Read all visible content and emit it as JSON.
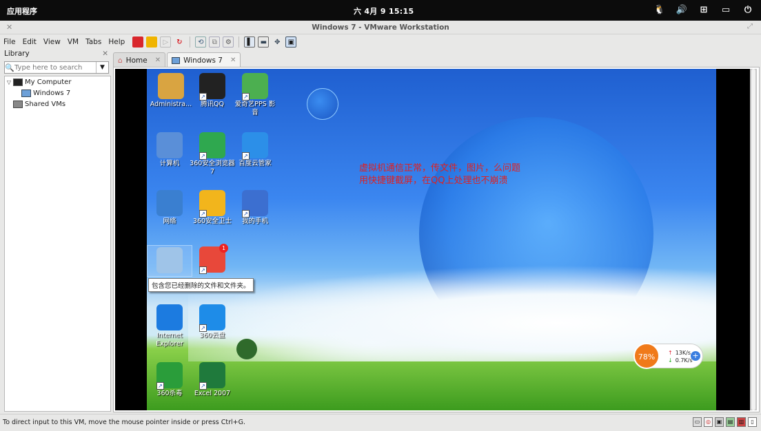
{
  "topbar": {
    "apps": "应用程序",
    "clock": "六 4月 9  15:15",
    "tray_icons": [
      "tux-icon",
      "volume-icon",
      "network-icon",
      "battery-icon",
      "power-icon"
    ]
  },
  "window": {
    "title": "Windows 7 - VMware Workstation"
  },
  "menu": [
    "File",
    "Edit",
    "View",
    "VM",
    "Tabs",
    "Help"
  ],
  "library": {
    "title": "Library",
    "search_placeholder": "Type here to search",
    "tree": [
      {
        "label": "My Computer"
      },
      {
        "label": "Windows 7"
      },
      {
        "label": "Shared VMs"
      }
    ]
  },
  "tabs": [
    {
      "label": "Home"
    },
    {
      "label": "Windows 7"
    }
  ],
  "desktop": {
    "icons": [
      {
        "label": "Administra...",
        "color": "#d9a441"
      },
      {
        "label": "腾讯QQ",
        "color": "#222222"
      },
      {
        "label": "爱奇艺PPS 影音",
        "color": "#4caf50"
      },
      {
        "label": "计算机",
        "color": "#5a8fd8"
      },
      {
        "label": "360安全浏览器7",
        "color": "#2fa84f"
      },
      {
        "label": "百度云管家",
        "color": "#2c8fe8"
      },
      {
        "label": "网络",
        "color": "#3a7fd0"
      },
      {
        "label": "360安全卫士",
        "color": "#f2b51c"
      },
      {
        "label": "我的手机",
        "color": "#3c6fd0"
      },
      {
        "label": "",
        "color": "#9fc4e8"
      },
      {
        "label": "",
        "color": "#e8483a"
      },
      {
        "label": "Internet Explorer",
        "color": "#1c7be0"
      },
      {
        "label": "360云盘",
        "color": "#1e8ce8"
      },
      {
        "label": "360杀毒",
        "color": "#2a9d3a"
      },
      {
        "label": "Excel 2007",
        "color": "#1f7a3c"
      }
    ],
    "badge": "1",
    "tooltip": "包含您已经删除的文件和文件夹。",
    "note_line1": "虚拟机通信正常，传文件，图片，么问题",
    "note_line2": "用快捷键截屏，在QQ上处理也不崩溃",
    "speed": {
      "percent": "78%",
      "up": "13K/s",
      "down": "0.7K/s"
    }
  },
  "status": {
    "message": "To direct input to this VM, move the mouse pointer inside or press Ctrl+G."
  }
}
